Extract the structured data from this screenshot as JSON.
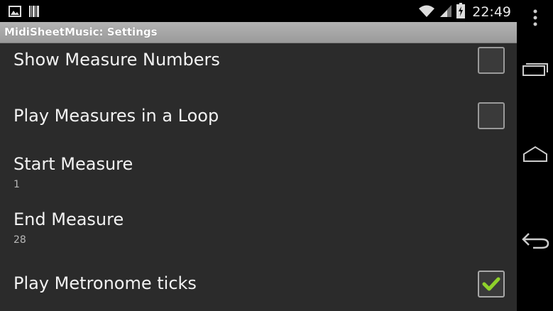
{
  "status_bar": {
    "time": "22:49",
    "left_icons": [
      "picture-icon",
      "barcode-icon"
    ],
    "right_icons": [
      "wifi-icon",
      "signal-icon",
      "battery-charging-icon"
    ]
  },
  "title_bar": {
    "title": "MidiSheetMusic: Settings"
  },
  "preferences": [
    {
      "label": "Show Measure Numbers",
      "type": "checkbox",
      "checked": false
    },
    {
      "label": "Play Measures in a Loop",
      "type": "checkbox",
      "checked": false
    },
    {
      "label": "Start Measure",
      "summary": "1",
      "type": "value"
    },
    {
      "label": "End Measure",
      "summary": "28",
      "type": "value"
    },
    {
      "label": "Play Metronome ticks",
      "type": "checkbox",
      "checked": true
    }
  ],
  "navigation": {
    "buttons": [
      "menu-icon",
      "recent-apps-icon",
      "home-icon",
      "back-icon"
    ]
  },
  "colors": {
    "checkmark": "#8fd12b",
    "background": "#2b2b2b",
    "title_bar": "#a6a6a6"
  }
}
